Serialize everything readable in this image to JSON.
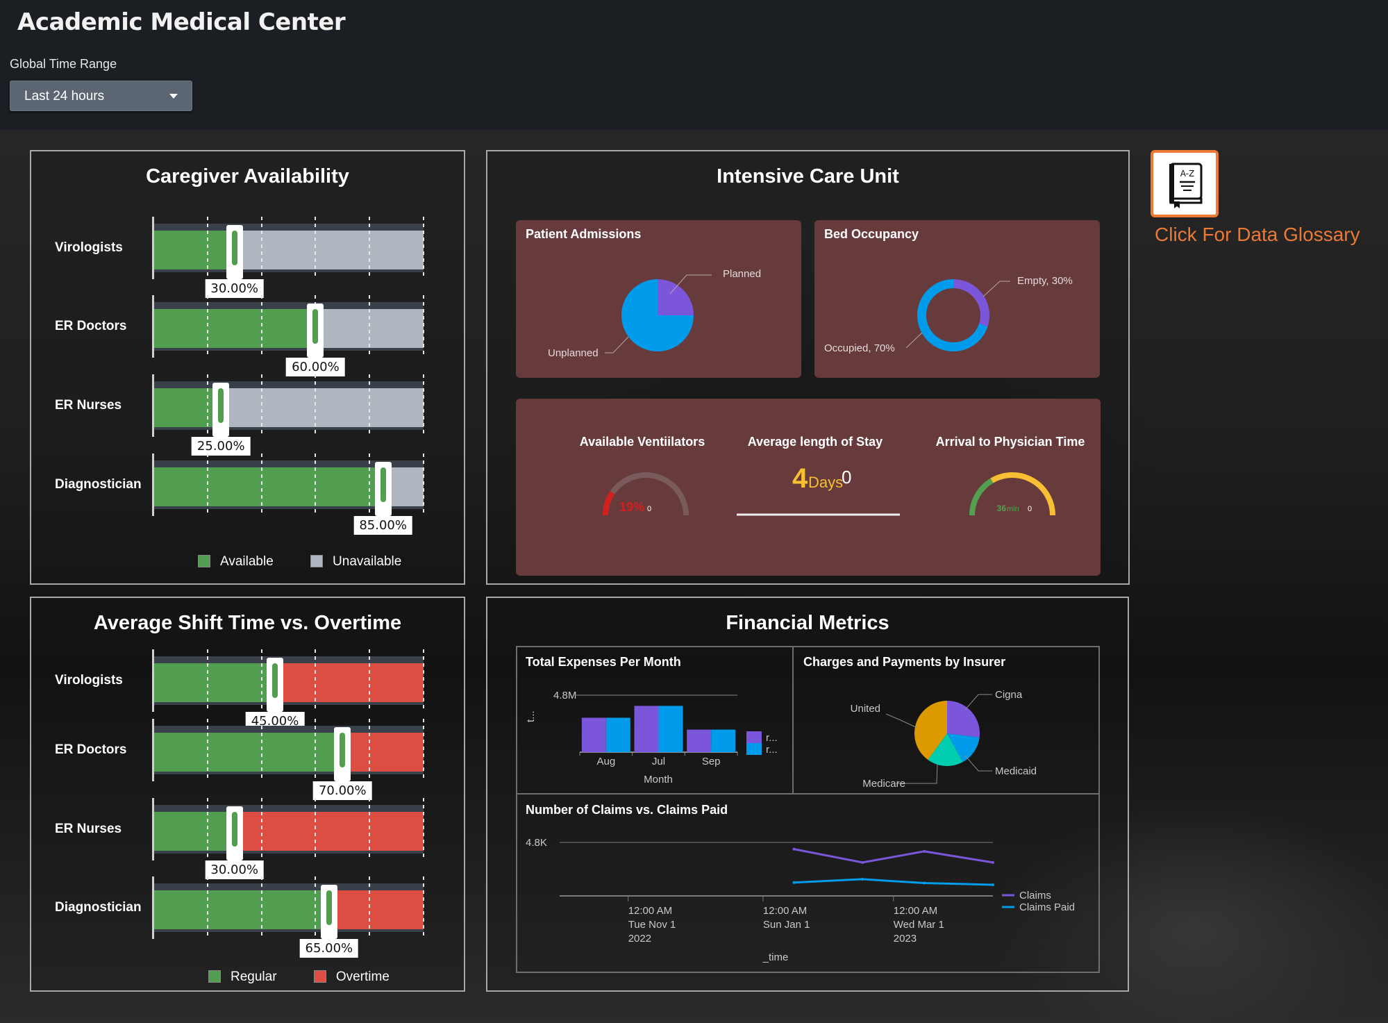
{
  "header": {
    "title": "Academic Medical Center",
    "time_range_label": "Global Time Range",
    "time_range_value": "Last 24 hours"
  },
  "glossary": {
    "icon_label": "A-Z",
    "link_text": "Click For Data Glossary",
    "accent_color": "#ec7a35"
  },
  "caregiver": {
    "title": "Caregiver Availability",
    "rows": [
      {
        "label": "Virologists",
        "value": 30,
        "value_label": "30.00%"
      },
      {
        "label": "ER Doctors",
        "value": 60,
        "value_label": "60.00%"
      },
      {
        "label": "ER Nurses",
        "value": 25,
        "value_label": "25.00%"
      },
      {
        "label": "Diagnostician",
        "value": 85,
        "value_label": "85.00%"
      }
    ],
    "legend": [
      {
        "label": "Available",
        "color": "#529e50"
      },
      {
        "label": "Unavailable",
        "color": "#b0b6bf"
      }
    ]
  },
  "shift": {
    "title": "Average Shift Time vs. Overtime",
    "rows": [
      {
        "label": "Virologists",
        "value": 45,
        "value_label": "45.00%"
      },
      {
        "label": "ER Doctors",
        "value": 70,
        "value_label": "70.00%"
      },
      {
        "label": "ER Nurses",
        "value": 30,
        "value_label": "30.00%"
      },
      {
        "label": "Diagnostician",
        "value": 65,
        "value_label": "65.00%"
      }
    ],
    "legend": [
      {
        "label": "Regular",
        "color": "#529e50"
      },
      {
        "label": "Overtime",
        "color": "#dc4e41"
      }
    ]
  },
  "icu": {
    "title": "Intensive Care Unit",
    "patient_admissions": {
      "title": "Patient Admissions",
      "slices": [
        {
          "label": "Planned",
          "value": 25,
          "color": "#7b56db"
        },
        {
          "label": "Unplanned",
          "value": 75,
          "color": "#009ceb"
        }
      ]
    },
    "bed_occupancy": {
      "title": "Bed Occupancy",
      "slices": [
        {
          "label": "Empty, 30%",
          "value": 30,
          "color": "#7b56db"
        },
        {
          "label": "Occupied, 70%",
          "value": 70,
          "color": "#009ceb"
        }
      ]
    },
    "ventilators": {
      "title": "Available Ventiilators",
      "value": 19,
      "value_text": "19%",
      "min_text": "0",
      "color": "#d41f1f"
    },
    "length_of_stay": {
      "title": "Average length of Stay",
      "value_number": "4",
      "value_unit": "Days",
      "delta": "0",
      "color": "#f8be34"
    },
    "arrival_time": {
      "title": "Arrival to Physician Time",
      "value": 36,
      "value_number": "36",
      "value_unit": "min",
      "min_text": "0",
      "green_fraction": 0.33,
      "color_good": "#53a051",
      "color_warn": "#f8be34"
    }
  },
  "financial": {
    "title": "Financial Metrics",
    "expenses_title": "Total Expenses Per Month",
    "insurer_title": "Charges and Payments by Insurer",
    "claims_title": "Number of Claims vs. Claims Paid"
  },
  "chart_data": [
    {
      "id": "expenses",
      "type": "bar",
      "title": "Total Expenses Per Month",
      "categories": [
        "Aug",
        "Jul",
        "Sep"
      ],
      "series": [
        {
          "name": "r...",
          "values": [
            2.9,
            3.9,
            1.9
          ],
          "color": "#7b56db"
        },
        {
          "name": "r...",
          "values": [
            2.9,
            3.9,
            1.9
          ],
          "color": "#009ceb"
        }
      ],
      "units": "M",
      "xlabel": "Month",
      "ylabel": "t...",
      "yticks": [
        "4.8M"
      ],
      "ylim": [
        0,
        4.8
      ],
      "grid": true,
      "legend": "right"
    },
    {
      "id": "insurer",
      "type": "pie",
      "title": "Charges and Payments by Insurer",
      "slices": [
        {
          "label": "Cigna",
          "value": 27,
          "color": "#7b56db"
        },
        {
          "label": "Medicaid",
          "value": 15,
          "color": "#009ceb"
        },
        {
          "label": "Medicare",
          "value": 18,
          "color": "#00cdaf"
        },
        {
          "label": "United",
          "value": 40,
          "color": "#dd9900"
        }
      ]
    },
    {
      "id": "claims",
      "type": "line",
      "title": "Number of Claims vs. Claims Paid",
      "x": [
        "2023-01-15",
        "2023-02-15",
        "2023-03-15",
        "2023-04-15"
      ],
      "series": [
        {
          "name": "Claims",
          "values": [
            4.2,
            3.0,
            4.0,
            3.0
          ],
          "color": "#7b56db"
        },
        {
          "name": "Claims Paid",
          "values": [
            1.2,
            1.5,
            1.15,
            1.0
          ],
          "color": "#009ceb"
        }
      ],
      "units": "K",
      "xlabel": "_time",
      "xticks": [
        {
          "date": "2022-11-01",
          "lines": [
            "12:00 AM",
            "Tue Nov 1",
            "2022"
          ]
        },
        {
          "date": "2023-01-01",
          "lines": [
            "12:00 AM",
            "Sun Jan 1",
            ""
          ]
        },
        {
          "date": "2023-03-01",
          "lines": [
            "12:00 AM",
            "Wed Mar 1",
            "2023"
          ]
        }
      ],
      "yticks": [
        "4.8K"
      ],
      "ylim": [
        0,
        4.8
      ],
      "xlim": [
        "2022-10-01",
        "2023-04-15"
      ],
      "grid": true,
      "legend": "right"
    }
  ]
}
